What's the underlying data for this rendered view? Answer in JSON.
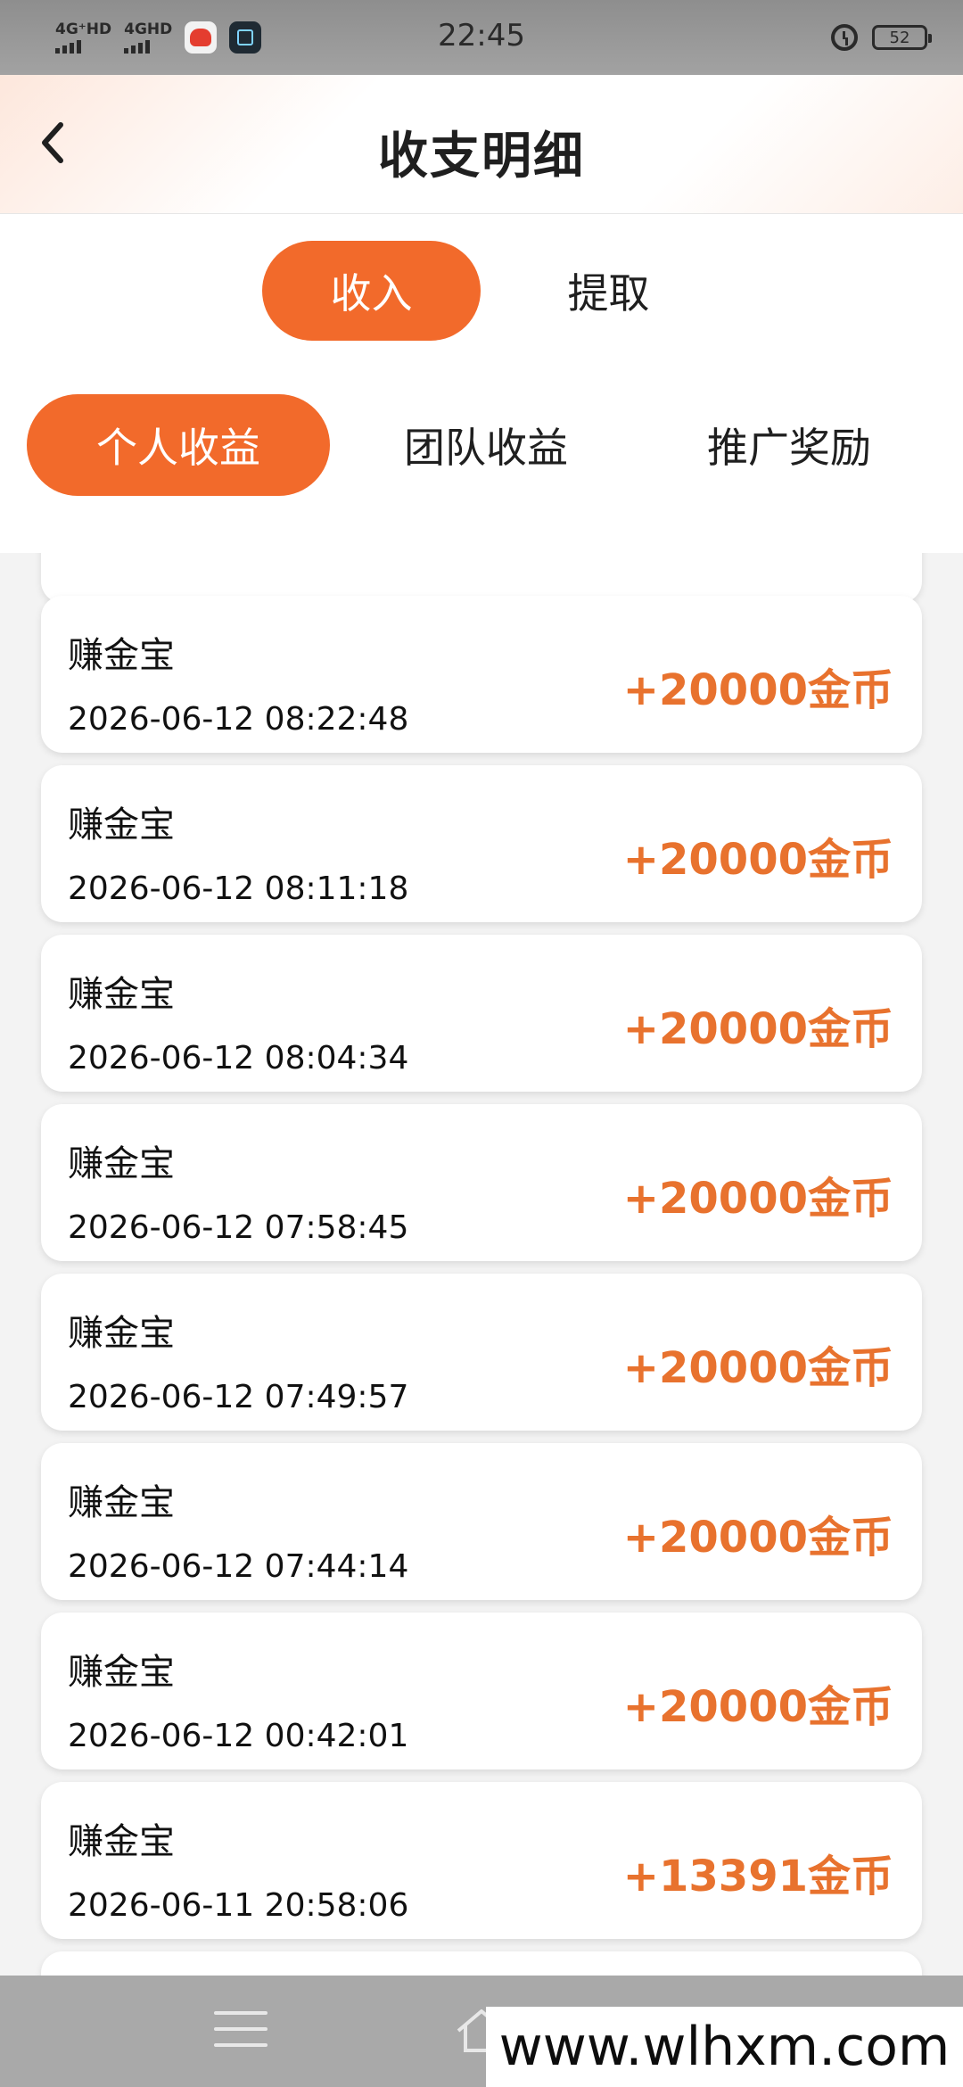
{
  "status_bar": {
    "time": "22:45",
    "network_1": "4G⁺HD",
    "network_2": "4GHD",
    "battery": "52"
  },
  "header": {
    "title": "收支明细"
  },
  "main_tabs": [
    {
      "label": "收入",
      "active": true
    },
    {
      "label": "提取",
      "active": false
    }
  ],
  "sub_tabs": [
    {
      "label": "个人收益",
      "active": true
    },
    {
      "label": "团队收益",
      "active": false
    },
    {
      "label": "推广奖励",
      "active": false
    }
  ],
  "records": [
    {
      "title": "赚金宝",
      "time": "2026-06-12 08:22:48",
      "amount": "+20000金币"
    },
    {
      "title": "赚金宝",
      "time": "2026-06-12 08:11:18",
      "amount": "+20000金币"
    },
    {
      "title": "赚金宝",
      "time": "2026-06-12 08:04:34",
      "amount": "+20000金币"
    },
    {
      "title": "赚金宝",
      "time": "2026-06-12 07:58:45",
      "amount": "+20000金币"
    },
    {
      "title": "赚金宝",
      "time": "2026-06-12 07:49:57",
      "amount": "+20000金币"
    },
    {
      "title": "赚金宝",
      "time": "2026-06-12 07:44:14",
      "amount": "+20000金币"
    },
    {
      "title": "赚金宝",
      "time": "2026-06-12 00:42:01",
      "amount": "+20000金币"
    },
    {
      "title": "赚金宝",
      "time": "2026-06-11 20:58:06",
      "amount": "+13391金币"
    }
  ],
  "watermark": "www.wlhxm.com",
  "colors": {
    "accent": "#f26a2b",
    "amount": "#e8722e",
    "nav_bar": "#a9a9a9"
  },
  "icons": [
    "back-arrow-icon",
    "alarm-icon",
    "battery-icon",
    "menu-icon",
    "home-icon",
    "back-icon"
  ]
}
